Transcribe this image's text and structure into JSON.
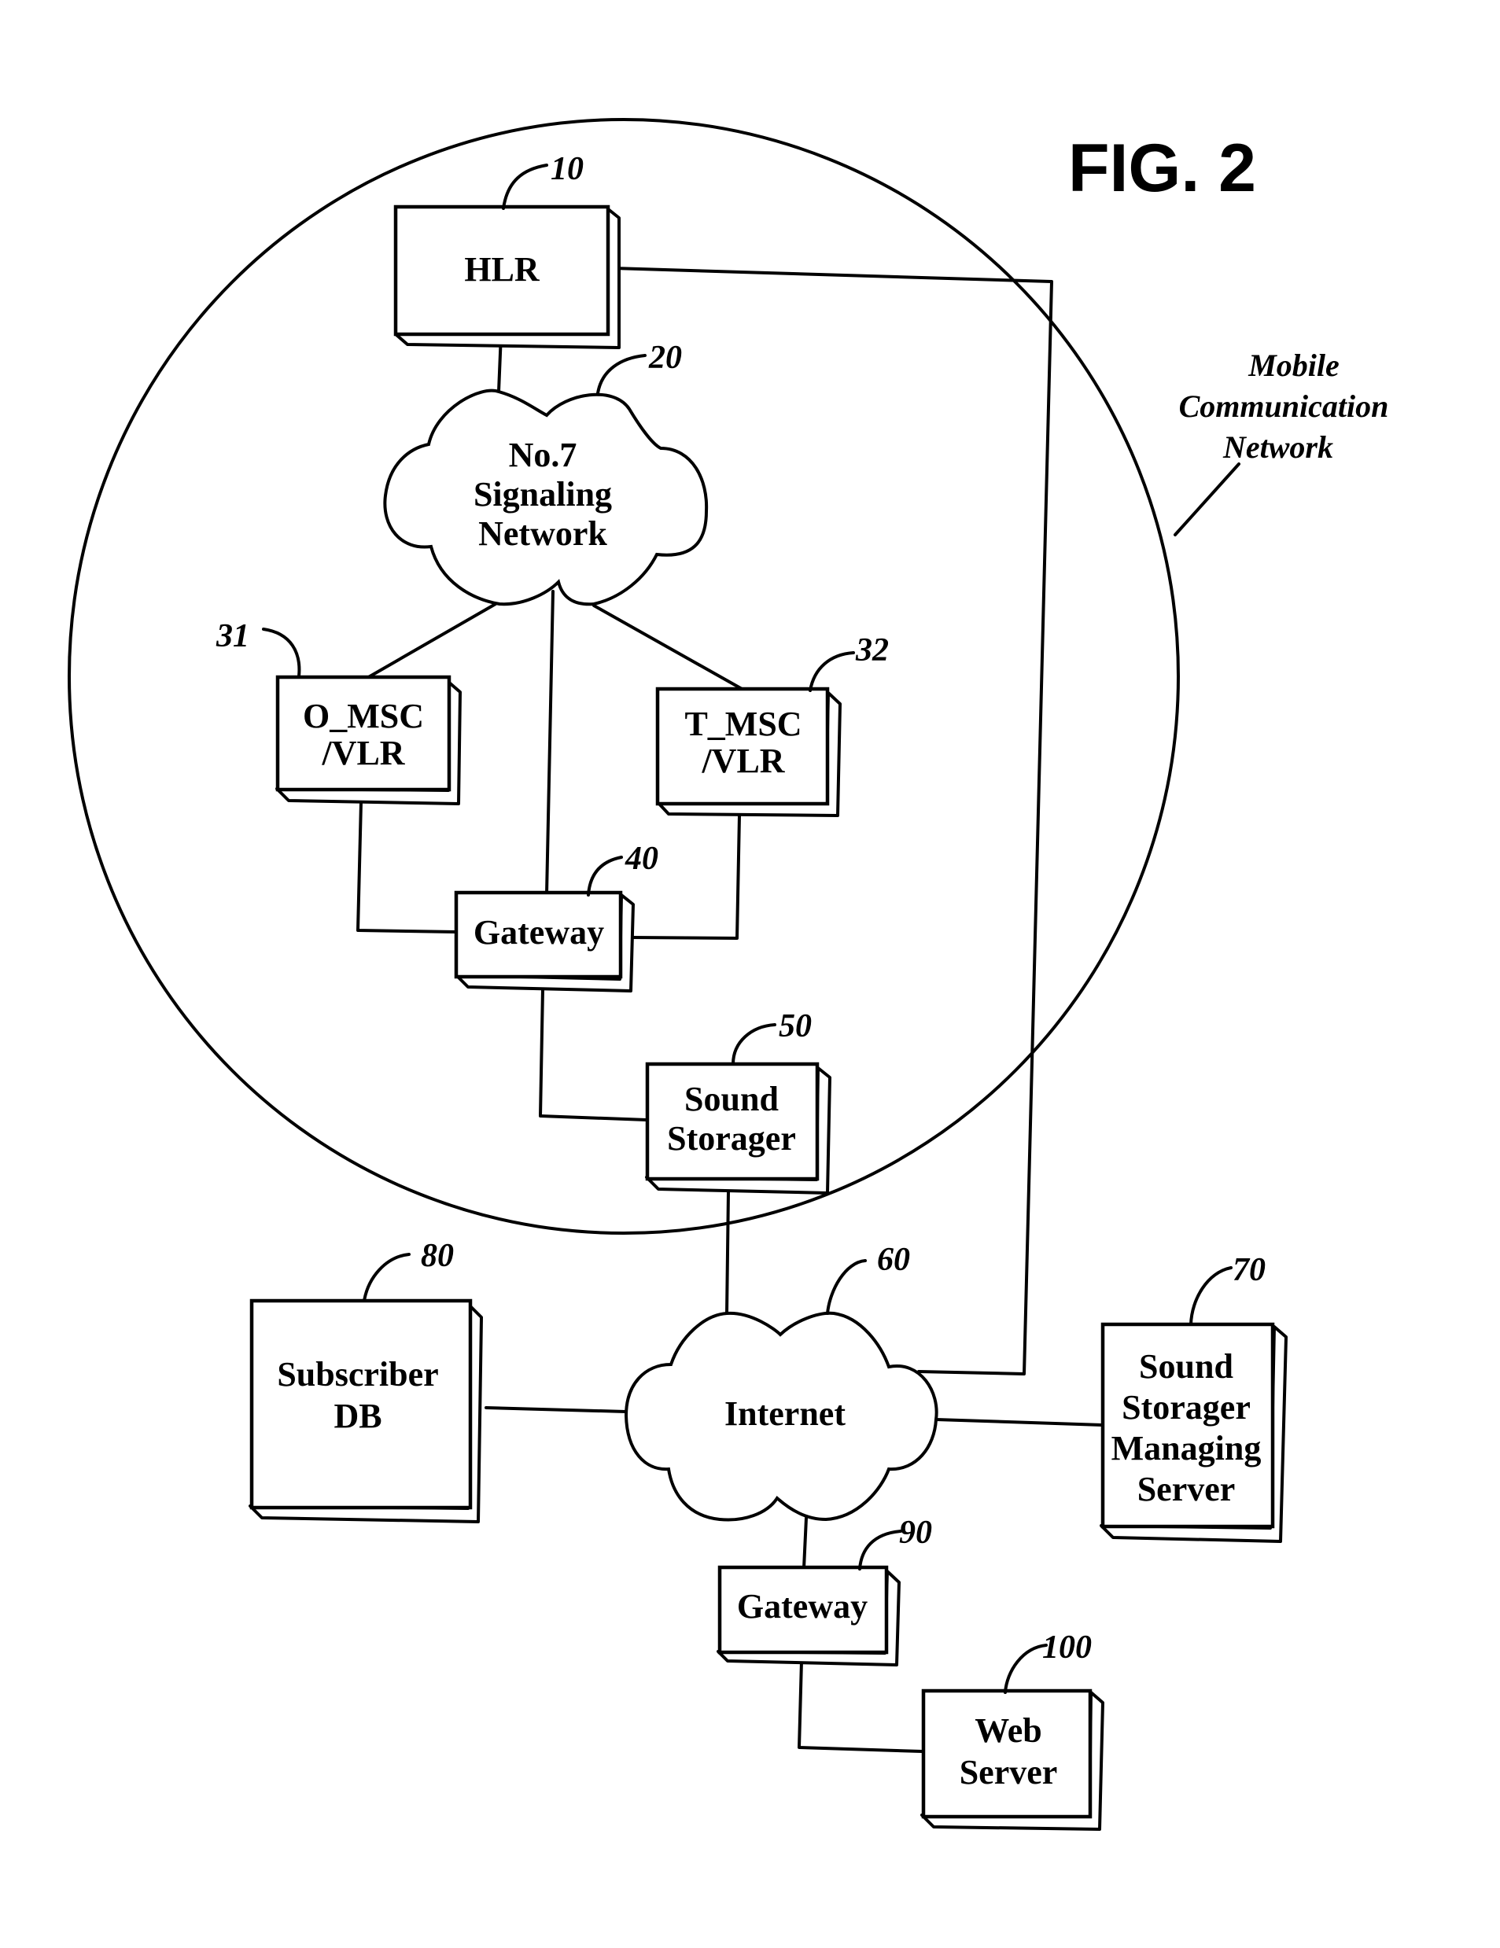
{
  "figure": {
    "title": "FIG. 2",
    "network_region": {
      "label_lines": [
        "Mobile",
        "Communication",
        "Network"
      ]
    }
  },
  "nodes": {
    "hlr": {
      "ref": "10",
      "label_lines": [
        "HLR"
      ]
    },
    "signaling_network": {
      "ref": "20",
      "label_lines": [
        "No.7",
        "Signaling",
        "Network"
      ]
    },
    "o_msc_vlr": {
      "ref": "31",
      "label_lines": [
        "O_MSC",
        "/VLR"
      ]
    },
    "t_msc_vlr": {
      "ref": "32",
      "label_lines": [
        "T_MSC",
        "/VLR"
      ]
    },
    "gateway_mobile": {
      "ref": "40",
      "label_lines": [
        "Gateway"
      ]
    },
    "sound_storager": {
      "ref": "50",
      "label_lines": [
        "Sound",
        "Storager"
      ]
    },
    "internet": {
      "ref": "60",
      "label_lines": [
        "Internet"
      ]
    },
    "sound_storager_managing_server": {
      "ref": "70",
      "label_lines": [
        "Sound",
        "Storager",
        "Managing",
        "Server"
      ]
    },
    "subscriber_db": {
      "ref": "80",
      "label_lines": [
        "Subscriber",
        "DB"
      ]
    },
    "gateway_internet": {
      "ref": "90",
      "label_lines": [
        "Gateway"
      ]
    },
    "web_server": {
      "ref": "100",
      "label_lines": [
        "Web",
        "Server"
      ]
    }
  },
  "connections": [
    {
      "from": "HLR",
      "to": "No.7 Signaling Network"
    },
    {
      "from": "HLR",
      "to": "Internet"
    },
    {
      "from": "No.7 Signaling Network",
      "to": "O_MSC/VLR"
    },
    {
      "from": "No.7 Signaling Network",
      "to": "T_MSC/VLR"
    },
    {
      "from": "No.7 Signaling Network",
      "to": "Gateway (40)"
    },
    {
      "from": "O_MSC/VLR",
      "to": "Gateway (40)"
    },
    {
      "from": "T_MSC/VLR",
      "to": "Gateway (40)"
    },
    {
      "from": "Gateway (40)",
      "to": "Sound Storager"
    },
    {
      "from": "Sound Storager",
      "to": "Internet"
    },
    {
      "from": "Subscriber DB",
      "to": "Internet"
    },
    {
      "from": "Internet",
      "to": "Sound Storager Managing Server"
    },
    {
      "from": "Internet",
      "to": "Gateway (90)"
    },
    {
      "from": "Gateway (90)",
      "to": "Web Server"
    }
  ]
}
